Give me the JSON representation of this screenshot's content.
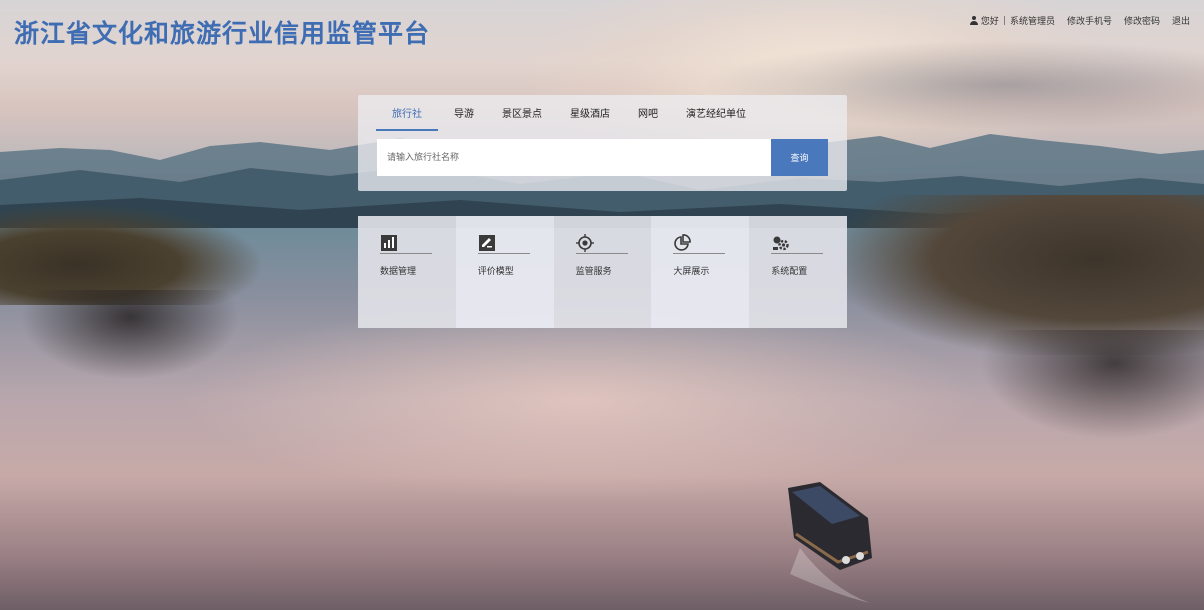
{
  "header": {
    "title": "浙江省文化和旅游行业信用监管平台",
    "greeting": "您好",
    "separator": "|",
    "username": "系统管理员",
    "links": {
      "change_phone": "修改手机号",
      "change_password": "修改密码",
      "logout": "退出"
    }
  },
  "search": {
    "tabs": [
      {
        "label": "旅行社",
        "active": true
      },
      {
        "label": "导游",
        "active": false
      },
      {
        "label": "景区景点",
        "active": false
      },
      {
        "label": "星级酒店",
        "active": false
      },
      {
        "label": "网吧",
        "active": false
      },
      {
        "label": "演艺经纪单位",
        "active": false
      }
    ],
    "placeholder": "请输入旅行社名称",
    "button": "查询"
  },
  "modules": [
    {
      "label": "数据管理",
      "icon": "bar-chart-icon"
    },
    {
      "label": "评价模型",
      "icon": "edit-document-icon"
    },
    {
      "label": "监管服务",
      "icon": "target-icon"
    },
    {
      "label": "大屏展示",
      "icon": "pie-chart-icon"
    },
    {
      "label": "系统配置",
      "icon": "settings-icon"
    }
  ],
  "colors": {
    "accent": "#4a78bd",
    "title": "#3f6db3",
    "panel": "#ececf0"
  }
}
